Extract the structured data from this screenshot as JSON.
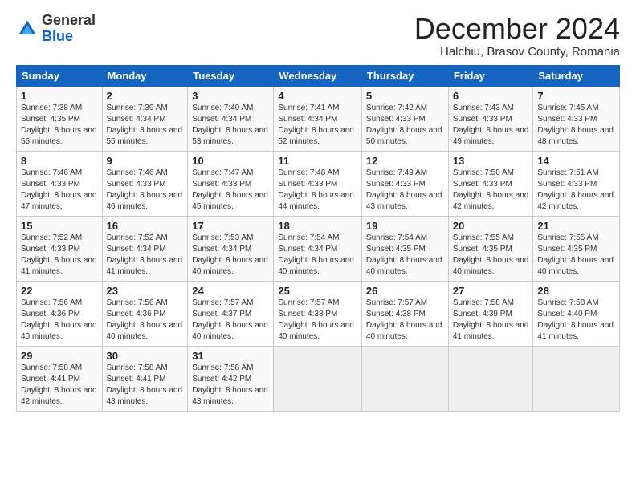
{
  "logo": {
    "general": "General",
    "blue": "Blue"
  },
  "title": "December 2024",
  "location": "Halchiu, Brasov County, Romania",
  "days_of_week": [
    "Sunday",
    "Monday",
    "Tuesday",
    "Wednesday",
    "Thursday",
    "Friday",
    "Saturday"
  ],
  "weeks": [
    [
      {
        "day": "1",
        "sunrise": "7:38 AM",
        "sunset": "4:35 PM",
        "daylight": "8 hours and 56 minutes."
      },
      {
        "day": "2",
        "sunrise": "7:39 AM",
        "sunset": "4:34 PM",
        "daylight": "8 hours and 55 minutes."
      },
      {
        "day": "3",
        "sunrise": "7:40 AM",
        "sunset": "4:34 PM",
        "daylight": "8 hours and 53 minutes."
      },
      {
        "day": "4",
        "sunrise": "7:41 AM",
        "sunset": "4:34 PM",
        "daylight": "8 hours and 52 minutes."
      },
      {
        "day": "5",
        "sunrise": "7:42 AM",
        "sunset": "4:33 PM",
        "daylight": "8 hours and 50 minutes."
      },
      {
        "day": "6",
        "sunrise": "7:43 AM",
        "sunset": "4:33 PM",
        "daylight": "8 hours and 49 minutes."
      },
      {
        "day": "7",
        "sunrise": "7:45 AM",
        "sunset": "4:33 PM",
        "daylight": "8 hours and 48 minutes."
      }
    ],
    [
      {
        "day": "8",
        "sunrise": "7:46 AM",
        "sunset": "4:33 PM",
        "daylight": "8 hours and 47 minutes."
      },
      {
        "day": "9",
        "sunrise": "7:46 AM",
        "sunset": "4:33 PM",
        "daylight": "8 hours and 46 minutes."
      },
      {
        "day": "10",
        "sunrise": "7:47 AM",
        "sunset": "4:33 PM",
        "daylight": "8 hours and 45 minutes."
      },
      {
        "day": "11",
        "sunrise": "7:48 AM",
        "sunset": "4:33 PM",
        "daylight": "8 hours and 44 minutes."
      },
      {
        "day": "12",
        "sunrise": "7:49 AM",
        "sunset": "4:33 PM",
        "daylight": "8 hours and 43 minutes."
      },
      {
        "day": "13",
        "sunrise": "7:50 AM",
        "sunset": "4:33 PM",
        "daylight": "8 hours and 42 minutes."
      },
      {
        "day": "14",
        "sunrise": "7:51 AM",
        "sunset": "4:33 PM",
        "daylight": "8 hours and 42 minutes."
      }
    ],
    [
      {
        "day": "15",
        "sunrise": "7:52 AM",
        "sunset": "4:33 PM",
        "daylight": "8 hours and 41 minutes."
      },
      {
        "day": "16",
        "sunrise": "7:52 AM",
        "sunset": "4:34 PM",
        "daylight": "8 hours and 41 minutes."
      },
      {
        "day": "17",
        "sunrise": "7:53 AM",
        "sunset": "4:34 PM",
        "daylight": "8 hours and 40 minutes."
      },
      {
        "day": "18",
        "sunrise": "7:54 AM",
        "sunset": "4:34 PM",
        "daylight": "8 hours and 40 minutes."
      },
      {
        "day": "19",
        "sunrise": "7:54 AM",
        "sunset": "4:35 PM",
        "daylight": "8 hours and 40 minutes."
      },
      {
        "day": "20",
        "sunrise": "7:55 AM",
        "sunset": "4:35 PM",
        "daylight": "8 hours and 40 minutes."
      },
      {
        "day": "21",
        "sunrise": "7:55 AM",
        "sunset": "4:35 PM",
        "daylight": "8 hours and 40 minutes."
      }
    ],
    [
      {
        "day": "22",
        "sunrise": "7:56 AM",
        "sunset": "4:36 PM",
        "daylight": "8 hours and 40 minutes."
      },
      {
        "day": "23",
        "sunrise": "7:56 AM",
        "sunset": "4:36 PM",
        "daylight": "8 hours and 40 minutes."
      },
      {
        "day": "24",
        "sunrise": "7:57 AM",
        "sunset": "4:37 PM",
        "daylight": "8 hours and 40 minutes."
      },
      {
        "day": "25",
        "sunrise": "7:57 AM",
        "sunset": "4:38 PM",
        "daylight": "8 hours and 40 minutes."
      },
      {
        "day": "26",
        "sunrise": "7:57 AM",
        "sunset": "4:38 PM",
        "daylight": "8 hours and 40 minutes."
      },
      {
        "day": "27",
        "sunrise": "7:58 AM",
        "sunset": "4:39 PM",
        "daylight": "8 hours and 41 minutes."
      },
      {
        "day": "28",
        "sunrise": "7:58 AM",
        "sunset": "4:40 PM",
        "daylight": "8 hours and 41 minutes."
      }
    ],
    [
      {
        "day": "29",
        "sunrise": "7:58 AM",
        "sunset": "4:41 PM",
        "daylight": "8 hours and 42 minutes."
      },
      {
        "day": "30",
        "sunrise": "7:58 AM",
        "sunset": "4:41 PM",
        "daylight": "8 hours and 43 minutes."
      },
      {
        "day": "31",
        "sunrise": "7:58 AM",
        "sunset": "4:42 PM",
        "daylight": "8 hours and 43 minutes."
      },
      null,
      null,
      null,
      null
    ]
  ]
}
